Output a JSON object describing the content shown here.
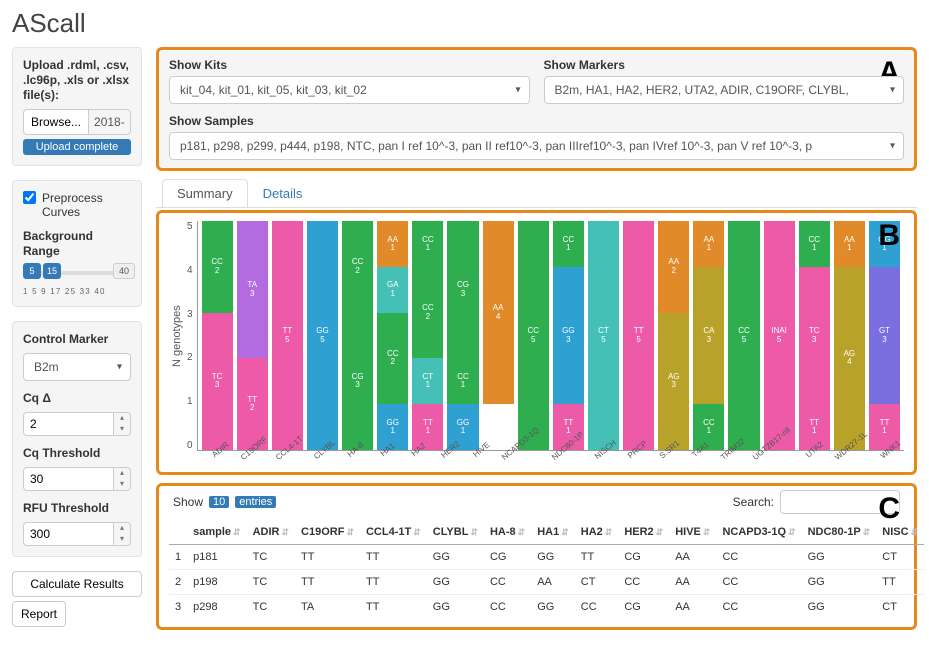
{
  "app_title": "AScall",
  "sidebar": {
    "upload_label": "Upload .rdml, .csv, .lc96p, .xls or .xlsx file(s):",
    "browse_label": "Browse...",
    "file_display": "2018-",
    "upload_status": "Upload complete",
    "preprocess_label": "Preprocess Curves",
    "preprocess_checked": true,
    "bg_range_label": "Background Range",
    "bg_range": {
      "low": "5",
      "high": "15",
      "max": "40",
      "ticks": "1  5  9  17  25  33  40"
    },
    "control_marker_label": "Control Marker",
    "control_marker_value": "B2m",
    "cq_delta_label": "Cq Δ",
    "cq_delta_value": "2",
    "cq_threshold_label": "Cq Threshold",
    "cq_threshold_value": "30",
    "rfu_threshold_label": "RFU Threshold",
    "rfu_threshold_value": "300",
    "calc_label": "Calculate Results",
    "report_label": "Report"
  },
  "filters": {
    "kits_label": "Show Kits",
    "kits_value": "kit_04, kit_01, kit_05, kit_03, kit_02",
    "markers_label": "Show Markers",
    "markers_value": "B2m, HA1, HA2, HER2, UTA2, ADIR, C19ORF, CLYBL,",
    "samples_label": "Show Samples",
    "samples_value": "p181, p298, p299, p444, p198, NTC, pan I ref 10^-3, pan II ref10^-3, pan IIIref10^-3, pan IVref 10^-3, pan V ref 10^-3, p"
  },
  "tabs": {
    "summary": "Summary",
    "details": "Details"
  },
  "chart_data": {
    "type": "bar",
    "ylabel": "N genotypes",
    "ylim": [
      0,
      5
    ],
    "yticks": [
      "0",
      "1",
      "2",
      "3",
      "4",
      "5"
    ],
    "categories": [
      "ADIR",
      "C19ORF",
      "CCL4-1T",
      "CLYBL",
      "HA-8",
      "HA1",
      "HA2",
      "HER2",
      "HIVE",
      "NCAPD3-1Q",
      "NDC80-1P",
      "NISCH",
      "PRCP",
      "S.SR1",
      "T4A1",
      "TRIM32",
      "UGT2B17-nll",
      "UTA2",
      "WDR27-1L",
      "WNK1"
    ],
    "palette": {
      "CC": "#2fae4f",
      "TC": "#ec5aa8",
      "TA": "#b56be0",
      "TT": "#ec5aa8",
      "GG": "#2ea0d1",
      "CG": "#2fae4f",
      "AA": "#e08a2a",
      "GA": "#44c0b6",
      "CT": "#44c0b6",
      "CA": "#b9a22a",
      "AG": "#b9a22a",
      "INAI": "#ec5aa8",
      "GT": "#7a6ee0"
    },
    "series": [
      [
        {
          "g": "CC",
          "n": 2
        },
        {
          "g": "TC",
          "n": 3
        }
      ],
      [
        {
          "g": "TA",
          "n": 3
        },
        {
          "g": "TT",
          "n": 2
        }
      ],
      [
        {
          "g": "TT",
          "n": 5
        }
      ],
      [
        {
          "g": "GG",
          "n": 5
        }
      ],
      [
        {
          "g": "CC",
          "n": 2
        },
        {
          "g": "CG",
          "n": 3
        }
      ],
      [
        {
          "g": "AA",
          "n": 1
        },
        {
          "g": "GA",
          "n": 1
        },
        {
          "g": "CC",
          "n": 2
        },
        {
          "g": "GG",
          "n": 1
        }
      ],
      [
        {
          "g": "CC",
          "n": 1
        },
        {
          "g": "CC",
          "n": 2
        },
        {
          "g": "CT",
          "n": 1
        },
        {
          "g": "TT",
          "n": 1
        }
      ],
      [
        {
          "g": "CG",
          "n": 3
        },
        {
          "g": "CC",
          "n": 1
        },
        {
          "g": "GG",
          "n": 1
        }
      ],
      [
        {
          "g": "AA",
          "n": 4
        },
        {
          "g": null,
          "n": 1
        }
      ],
      [
        {
          "g": "CC",
          "n": 5
        }
      ],
      [
        {
          "g": "CC",
          "n": 1
        },
        {
          "g": "GG",
          "n": 3
        },
        {
          "g": "TT",
          "n": 1
        }
      ],
      [
        {
          "g": "CT",
          "n": 5
        }
      ],
      [
        {
          "g": "TT",
          "n": 5
        }
      ],
      [
        {
          "g": "AA",
          "n": 2
        },
        {
          "g": "AG",
          "n": 3
        }
      ],
      [
        {
          "g": "AA",
          "n": 1
        },
        {
          "g": "CA",
          "n": 3
        },
        {
          "g": "CC",
          "n": 1
        }
      ],
      [
        {
          "g": "CC",
          "n": 5
        }
      ],
      [
        {
          "g": "INAI",
          "n": 5
        }
      ],
      [
        {
          "g": "CC",
          "n": 1
        },
        {
          "g": "TC",
          "n": 3
        },
        {
          "g": "TT",
          "n": 1
        }
      ],
      [
        {
          "g": "AA",
          "n": 1
        },
        {
          "g": "AG",
          "n": 4
        }
      ],
      [
        {
          "g": "GG",
          "n": 1
        },
        {
          "g": "GT",
          "n": 3
        },
        {
          "g": "TT",
          "n": 1
        }
      ]
    ]
  },
  "table": {
    "show_label": "Show",
    "show_n": "10",
    "entries_label": "entries",
    "search_label": "Search:",
    "columns": [
      "",
      "sample",
      "ADIR",
      "C19ORF",
      "CCL4-1T",
      "CLYBL",
      "HA-8",
      "HA1",
      "HA2",
      "HER2",
      "HIVE",
      "NCAPD3-1Q",
      "NDC80-1P",
      "NISC"
    ],
    "rows": [
      [
        "1",
        "p181",
        "TC",
        "TT",
        "TT",
        "GG",
        "CG",
        "GG",
        "TT",
        "CG",
        "AA",
        "CC",
        "GG",
        "CT"
      ],
      [
        "2",
        "p198",
        "TC",
        "TT",
        "TT",
        "GG",
        "CC",
        "AA",
        "CT",
        "CC",
        "AA",
        "CC",
        "GG",
        "TT"
      ],
      [
        "3",
        "p298",
        "TC",
        "TA",
        "TT",
        "GG",
        "CC",
        "GG",
        "CC",
        "CG",
        "AA",
        "CC",
        "GG",
        "CT"
      ]
    ]
  },
  "annot": {
    "a": "A",
    "b": "B",
    "c": "C"
  }
}
